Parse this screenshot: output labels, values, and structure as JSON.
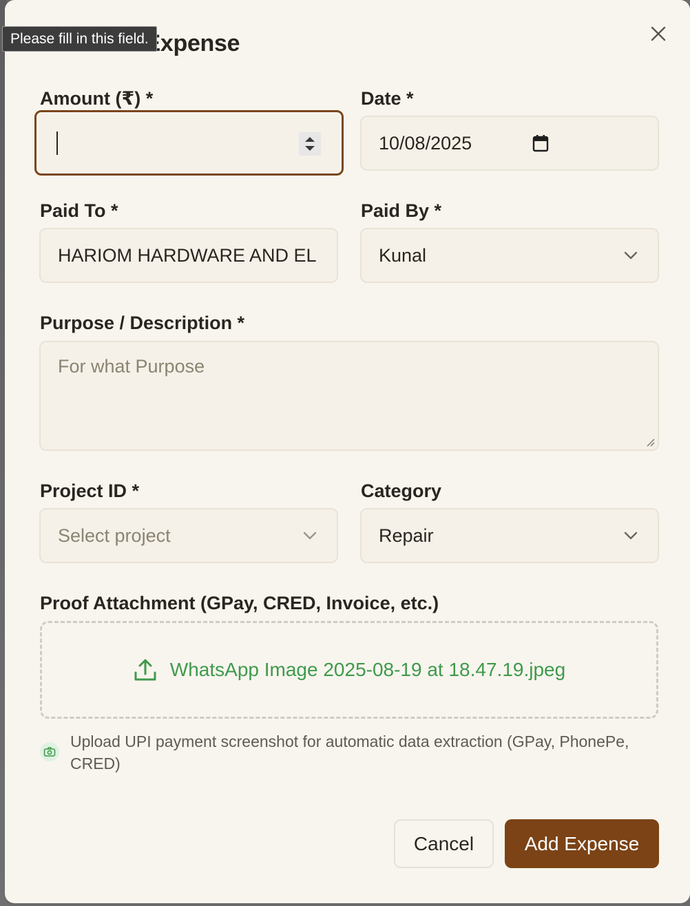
{
  "tooltip": {
    "text": "Please fill in this field."
  },
  "dialog": {
    "title": "Add New Expense"
  },
  "amount": {
    "label": "Amount (₹) *",
    "value": ""
  },
  "date": {
    "label": "Date *",
    "value": "10/08/2025"
  },
  "paid_to": {
    "label": "Paid To *",
    "value": "HARIOM HARDWARE AND EL"
  },
  "paid_by": {
    "label": "Paid By *",
    "value": "Kunal"
  },
  "purpose": {
    "label": "Purpose / Description *",
    "placeholder": "For what Purpose"
  },
  "project": {
    "label": "Project ID *",
    "placeholder": "Select project"
  },
  "category": {
    "label": "Category",
    "value": "Repair"
  },
  "attachment": {
    "label": "Proof Attachment (GPay, CRED, Invoice, etc.)",
    "filename": "WhatsApp Image 2025-08-19 at 18.47.19.jpeg"
  },
  "hint": {
    "text": "Upload UPI payment screenshot for automatic data extraction (GPay, PhonePe, CRED)"
  },
  "actions": {
    "cancel": "Cancel",
    "submit": "Add Expense"
  },
  "colors": {
    "accent": "#7b4316",
    "upload": "#3f9a4c",
    "background": "#f8f5ee"
  }
}
